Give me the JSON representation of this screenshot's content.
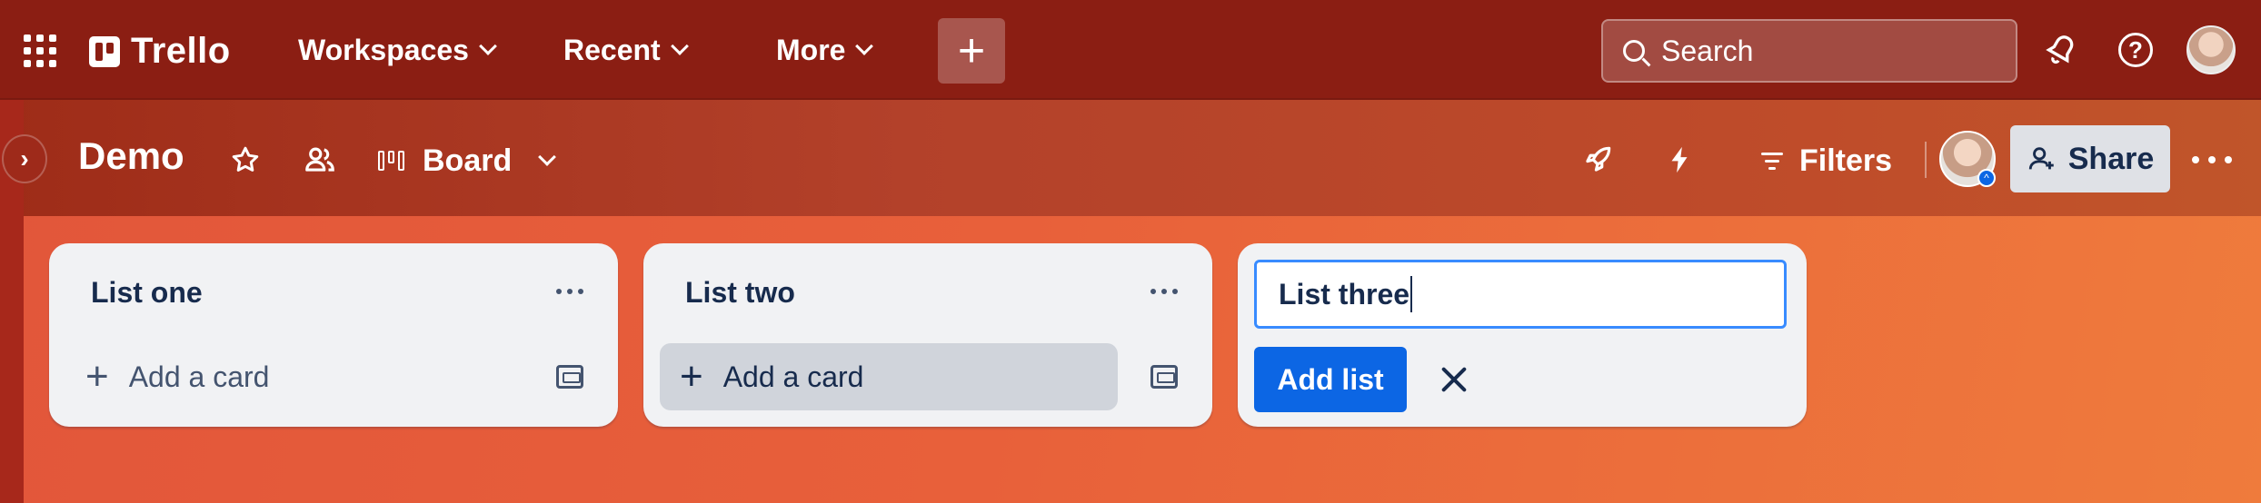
{
  "topbar": {
    "brand": "Trello",
    "nav": [
      {
        "label": "Workspaces"
      },
      {
        "label": "Recent"
      },
      {
        "label": "More"
      }
    ],
    "create_label": "+",
    "search_placeholder": "Search",
    "help_label": "?"
  },
  "board": {
    "title": "Demo",
    "view_label": "Board",
    "filters_label": "Filters",
    "share_label": "Share"
  },
  "lists": [
    {
      "title": "List one",
      "add_card_label": "Add a card"
    },
    {
      "title": "List two",
      "add_card_label": "Add a card"
    }
  ],
  "new_list": {
    "input_value": "List three",
    "add_button_label": "Add list"
  },
  "colors": {
    "topbar": "#8b1e13",
    "accent": "#0c66e4",
    "list_bg": "#f1f2f4"
  }
}
